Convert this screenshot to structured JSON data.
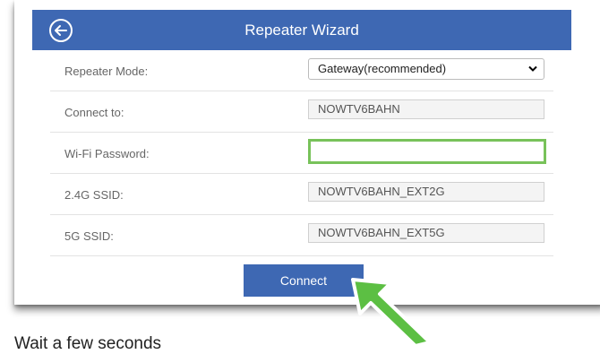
{
  "header": {
    "title": "Repeater Wizard",
    "back_icon": "back-arrow-circle-icon"
  },
  "form": {
    "rows": [
      {
        "label": "Repeater Mode:",
        "value": "Gateway(recommended)"
      },
      {
        "label": "Connect to:",
        "value": "NOWTV6BAHN"
      },
      {
        "label": "Wi-Fi Password:",
        "value": ""
      },
      {
        "label": "2.4G SSID:",
        "value": "NOWTV6BAHN_EXT2G"
      },
      {
        "label": "5G SSID:",
        "value": "NOWTV6BAHN_EXT5G"
      }
    ]
  },
  "actions": {
    "connect_label": "Connect"
  },
  "footer": {
    "text": "Wait a few seconds"
  },
  "colors": {
    "header": "#3e68b3",
    "button": "#3e68b3",
    "highlight": "#78c25a",
    "pointer_arrow": "#5cbf43"
  }
}
